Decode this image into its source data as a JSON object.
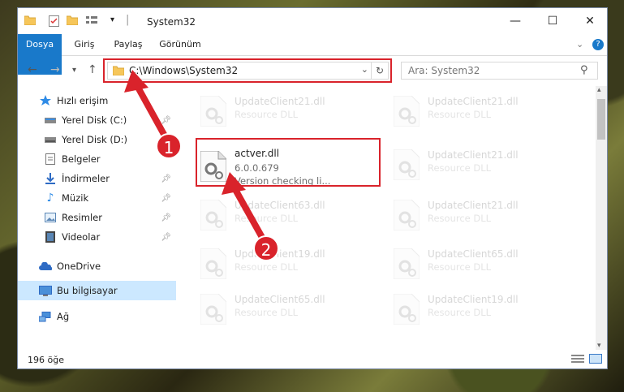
{
  "window": {
    "title": "System32"
  },
  "title_controls": {
    "minimize": "—",
    "maximize": "☐",
    "close": "✕"
  },
  "ribbon": {
    "tabs": [
      "Dosya",
      "Giriş",
      "Paylaş",
      "Görünüm"
    ]
  },
  "nav": {
    "address": "C:\\Windows\\System32",
    "search_placeholder": "Ara: System32"
  },
  "sidebar": {
    "items": [
      {
        "label": "Hızlı erişim",
        "icon": "star-icon"
      },
      {
        "label": "Yerel Disk (C:)",
        "icon": "drive-icon",
        "pinned": true
      },
      {
        "label": "Yerel Disk (D:)",
        "icon": "drive-icon"
      },
      {
        "label": "Belgeler",
        "icon": "documents-icon"
      },
      {
        "label": "İndirmeler",
        "icon": "download-icon",
        "pinned": true
      },
      {
        "label": "Müzik",
        "icon": "music-icon",
        "pinned": true
      },
      {
        "label": "Resimler",
        "icon": "pictures-icon",
        "pinned": true
      },
      {
        "label": "Videolar",
        "icon": "video-icon",
        "pinned": true
      },
      {
        "label": "OneDrive",
        "icon": "cloud-icon"
      },
      {
        "label": "Bu bilgisayar",
        "icon": "computer-icon",
        "selected": true
      },
      {
        "label": "Ağ",
        "icon": "network-icon"
      }
    ]
  },
  "files": [
    {
      "name": "UpdateClient21.dll",
      "type": "Resource DLL"
    },
    {
      "name": "UpdateClient21.dll",
      "type": "Resource DLL"
    },
    {
      "name": "actver.dll",
      "version": "6.0.0.679",
      "desc": "Version checking li...",
      "highlight": true
    },
    {
      "name": "UpdateClient21.dll",
      "type": "Resource DLL"
    },
    {
      "name": "UpdateClient63.dll",
      "type": "Resource DLL"
    },
    {
      "name": "UpdateClient21.dll",
      "type": "Resource DLL"
    },
    {
      "name": "UpdateClient19.dll",
      "type": "Resource DLL"
    },
    {
      "name": "UpdateClient65.dll",
      "type": "Resource DLL"
    },
    {
      "name": "UpdateClient65.dll",
      "type": "Resource DLL"
    },
    {
      "name": "UpdateClient19.dll",
      "type": "Resource DLL"
    }
  ],
  "status": {
    "count": "196 öğe"
  },
  "annotations": {
    "step1": "1",
    "step2": "2"
  },
  "colors": {
    "accent": "#1979ca",
    "highlight": "#d9232b",
    "selected": "#cce8ff"
  }
}
